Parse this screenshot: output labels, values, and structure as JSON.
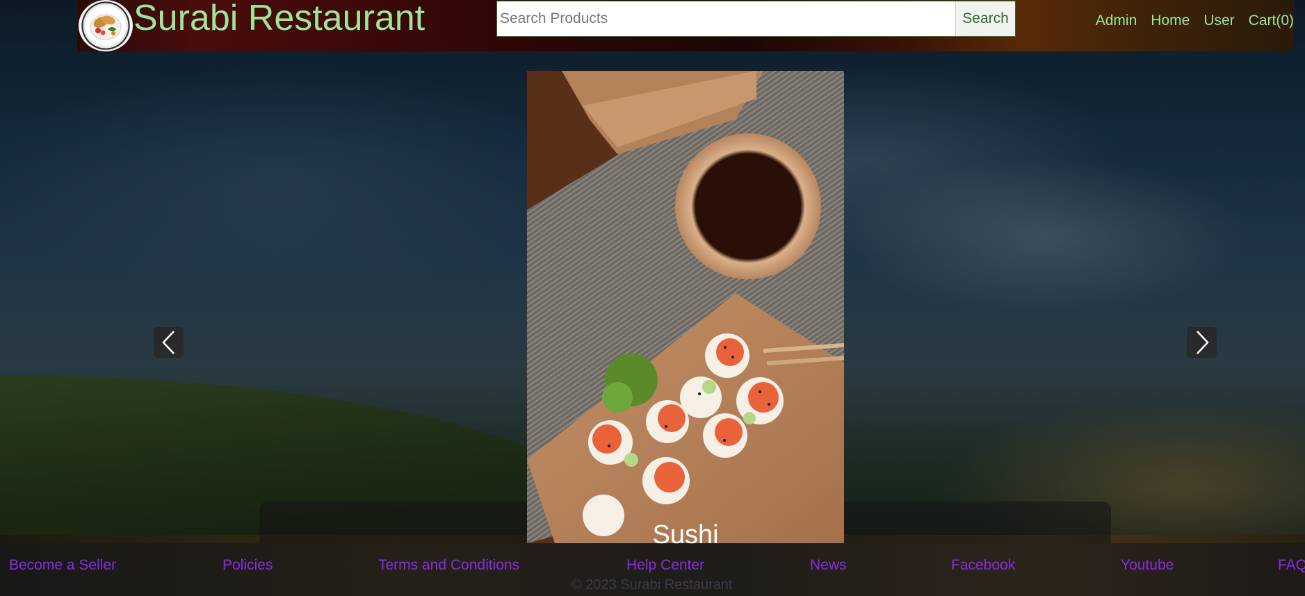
{
  "header": {
    "brand": "Surabi Restaurant",
    "logo_icon": "food-plate-icon",
    "search": {
      "placeholder": "Search Products",
      "value": "",
      "button_label": "Search"
    },
    "nav": [
      "Admin",
      "Home",
      "User",
      "Cart(0)"
    ]
  },
  "carousel": {
    "caption": "Sushi",
    "prev_icon": "chevron-left-icon",
    "next_icon": "chevron-right-icon"
  },
  "footer": {
    "links": [
      "Become a Seller",
      "Policies",
      "Terms and Conditions",
      "Help Center",
      "News",
      "Facebook",
      "Youtube",
      "FAQ"
    ],
    "copyright": "© 2023 Surabi Restaurant"
  },
  "colors": {
    "brand_green": "#9fe59a",
    "footer_link": "#8a2be2",
    "search_green": "#2f6a2f"
  }
}
